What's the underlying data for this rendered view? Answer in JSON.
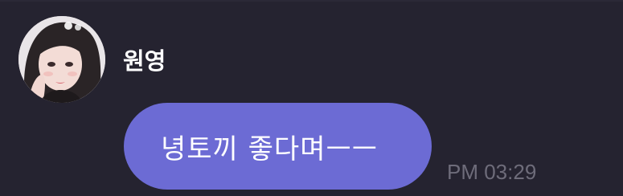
{
  "message": {
    "sender": "원영",
    "avatar_icon": "profile-photo",
    "text": "녕토끼 좋다며ㅡㅡ",
    "time": "PM 03:29"
  },
  "colors": {
    "background": "#252330",
    "bubble": "#6c6bd4",
    "sender_text": "#ffffff",
    "message_text": "#ffffff",
    "timestamp_text": "#6e6c7a"
  }
}
